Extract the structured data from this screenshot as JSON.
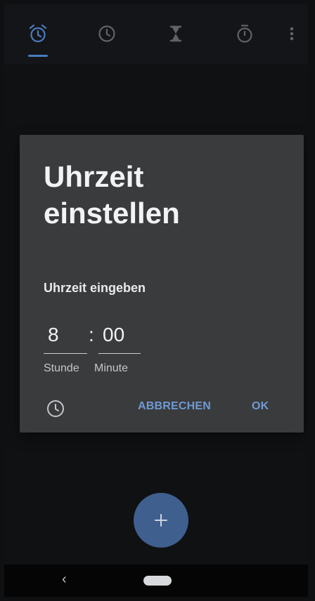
{
  "app": {
    "tabs": [
      {
        "icon": "alarm-icon",
        "active": true
      },
      {
        "icon": "clock-icon",
        "active": false
      },
      {
        "icon": "hourglass-timer-icon",
        "active": false
      },
      {
        "icon": "stopwatch-icon",
        "active": false
      }
    ],
    "overflow_icon": "more-vert-icon",
    "accent_color": "#4a7bbf"
  },
  "dialog": {
    "title": "Uhrzeit einstellen",
    "subtitle": "Uhrzeit eingeben",
    "hour_value": "8",
    "separator": ":",
    "minute_value": "00",
    "hour_label": "Stunde",
    "minute_label": "Minute",
    "toggle_icon": "clock-icon",
    "cancel_label": "ABBRECHEN",
    "ok_label": "OK",
    "button_color": "#6f9ad3"
  },
  "fab": {
    "icon": "plus-icon",
    "symbol": "+"
  },
  "navigation": {
    "back_symbol": "‹",
    "home_icon": "home-pill-icon"
  }
}
